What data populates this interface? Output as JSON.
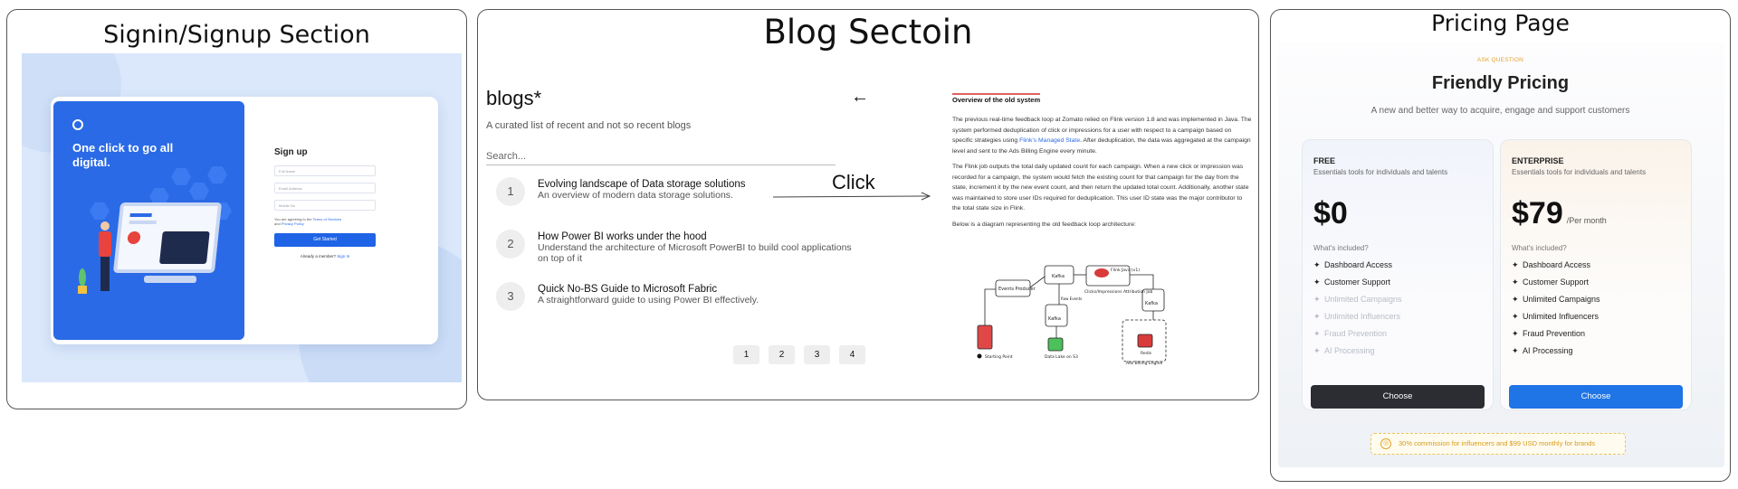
{
  "signin": {
    "panel_title": "Signin/Signup Section",
    "hero_text": "One click to go all digital.",
    "form_title": "Sign up",
    "full_name_placeholder": "Full Name",
    "email_placeholder": "Email Address",
    "mobile_placeholder": "Mobile No",
    "terms_prefix": "You are agreeing to the",
    "terms_link": "Terms of Services",
    "terms_and": "and",
    "privacy_link": "Privacy Policy",
    "submit_label": "Get Started",
    "already_text": "Already a member?",
    "signin_link": "Sign In",
    "colors": {
      "accent": "#2a6ae6",
      "background": "#dbe8fb"
    }
  },
  "blog": {
    "panel_title": "Blog Sectoin",
    "heading": "blogs*",
    "subheading": "A curated list of recent and not so recent blogs",
    "back_icon": "arrow-left-icon",
    "back_glyph": "←",
    "search_placeholder": "Search...",
    "click_label": "Click",
    "posts": [
      {
        "num": "1",
        "title": "Evolving landscape of Data storage solutions",
        "desc": "An overview of modern data storage solutions."
      },
      {
        "num": "2",
        "title": "How Power BI works under the hood",
        "desc": "Understand the architecture of Microsoft PowerBI to build cool applications on top of it"
      },
      {
        "num": "3",
        "title": "Quick No-BS Guide to Microsoft Fabric",
        "desc": "A straightforward guide to using Power BI effectively."
      }
    ],
    "pages": [
      "1",
      "2",
      "3",
      "4"
    ],
    "article": {
      "heading": "Overview of the old system",
      "p1_a": "The previous real-time feedback loop at Zomato relied on Flink version 1.8 and was implemented in Java. The system performed deduplication of click or impressions for a user with respect to a campaign based on specific strategies using",
      "p1_link": "Flink's Managed State",
      "p1_b": ". After deduplication, the data was aggregated at the campaign level and sent to the Ads Billing Engine every minute.",
      "p2": "The Flink job outputs the total daily updated count for each campaign. When a new click or impression was recorded for a campaign, the system would fetch the existing count for that campaign for the day from the state, increment it by the new event count, and then return the updated total count. Additionally, another state was maintained to store user IDs required for deduplication. This user ID state was the major contributor to the total state size in Flink.",
      "p3": "Below is a diagram representing the old feedback loop architecture:",
      "diagram": {
        "events_producer": "Events Producer",
        "kafka": "Kafka",
        "flink_job": "Flink Java (v1)",
        "flink_job_sub": "Clicks/Impressions Attribution Job",
        "raw_events": "Raw Events",
        "data_lake": "Data Lake on S3",
        "ads_billing": "Ads Billing Engine",
        "redis": "Redis",
        "starting_point": "Starting Point"
      }
    }
  },
  "pricing": {
    "panel_title": "Pricing Page",
    "eyebrow": "ASK QUESTION",
    "heading": "Friendly Pricing",
    "tagline": "A new and better way to acquire, engage and support customers",
    "plans": [
      {
        "name": "FREE",
        "subtitle": "Essentials tools for individuals and talents",
        "price": "$0",
        "per": "",
        "included_label": "What's included?",
        "features": [
          {
            "label": "Dashboard Access",
            "enabled": true
          },
          {
            "label": "Customer Support",
            "enabled": true
          },
          {
            "label": "Unlimited Campaigns",
            "enabled": false
          },
          {
            "label": "Unlimited Influencers",
            "enabled": false
          },
          {
            "label": "Fraud Prevention",
            "enabled": false
          },
          {
            "label": "AI Processing",
            "enabled": false
          }
        ],
        "cta": "Choose"
      },
      {
        "name": "ENTERPRISE",
        "subtitle": "Essentials tools for individuals and talents",
        "price": "$79",
        "per": "/Per month",
        "included_label": "What's included?",
        "features": [
          {
            "label": "Dashboard Access",
            "enabled": true
          },
          {
            "label": "Customer Support",
            "enabled": true
          },
          {
            "label": "Unlimited Campaigns",
            "enabled": true
          },
          {
            "label": "Unlimited Influencers",
            "enabled": true
          },
          {
            "label": "Fraud Prevention",
            "enabled": true
          },
          {
            "label": "AI Processing",
            "enabled": true
          }
        ],
        "cta": "Choose"
      }
    ],
    "feature_glyph": "✦",
    "commission_icon": "coin-icon",
    "commission_text": "30% commission for influencers and $99 USD monthly for brands",
    "colors": {
      "free_cta": "#2b2d33",
      "enterprise_cta": "#1f74e6",
      "eyebrow": "#e8a22b"
    }
  }
}
